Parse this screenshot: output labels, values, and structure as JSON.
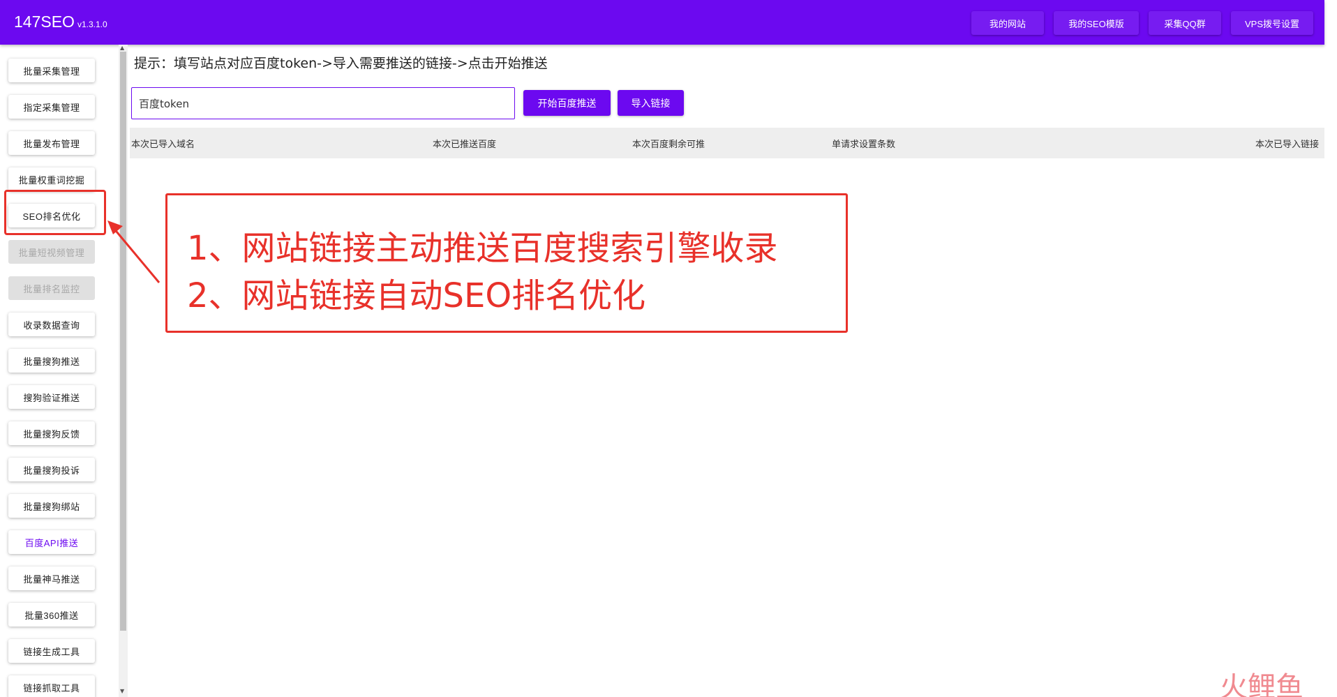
{
  "header": {
    "brand_name": "147SEO",
    "brand_version": "v1.3.1.0",
    "nav": [
      "我的网站",
      "我的SEO模版",
      "采集QQ群",
      "VPS拨号设置"
    ]
  },
  "sidebar": {
    "items": [
      {
        "label": "批量采集管理",
        "state": "normal"
      },
      {
        "label": "指定采集管理",
        "state": "normal"
      },
      {
        "label": "批量发布管理",
        "state": "normal"
      },
      {
        "label": "批量权重词挖掘",
        "state": "normal"
      },
      {
        "label": "SEO排名优化",
        "state": "normal"
      },
      {
        "label": "批量短视频管理",
        "state": "disabled"
      },
      {
        "label": "批量排名监控",
        "state": "disabled"
      },
      {
        "label": "收录数据查询",
        "state": "normal"
      },
      {
        "label": "批量搜狗推送",
        "state": "normal"
      },
      {
        "label": "搜狗验证推送",
        "state": "normal"
      },
      {
        "label": "批量搜狗反馈",
        "state": "normal"
      },
      {
        "label": "批量搜狗投诉",
        "state": "normal"
      },
      {
        "label": "批量搜狗绑站",
        "state": "normal"
      },
      {
        "label": "百度API推送",
        "state": "active"
      },
      {
        "label": "批量神马推送",
        "state": "normal"
      },
      {
        "label": "批量360推送",
        "state": "normal"
      },
      {
        "label": "链接生成工具",
        "state": "normal"
      },
      {
        "label": "链接抓取工具",
        "state": "normal"
      }
    ]
  },
  "main": {
    "hint": "提示：填写站点对应百度token->导入需要推送的链接->点击开始推送",
    "token_input": {
      "value": "百度token",
      "placeholder": "百度token"
    },
    "start_button": "开始百度推送",
    "import_button": "导入链接",
    "table_headers": [
      "本次已导入域名",
      "本次已推送百度",
      "本次百度剩余可推",
      "单请求设置条数",
      "本次已导入链接"
    ]
  },
  "annotation": {
    "line1": "1、网站链接主动推送百度搜索引擎收录",
    "line2": "2、网站链接自动SEO排名优化",
    "color": "#e8312a"
  },
  "watermark": "火鲤鱼",
  "colors": {
    "accent": "#6c09f0"
  }
}
